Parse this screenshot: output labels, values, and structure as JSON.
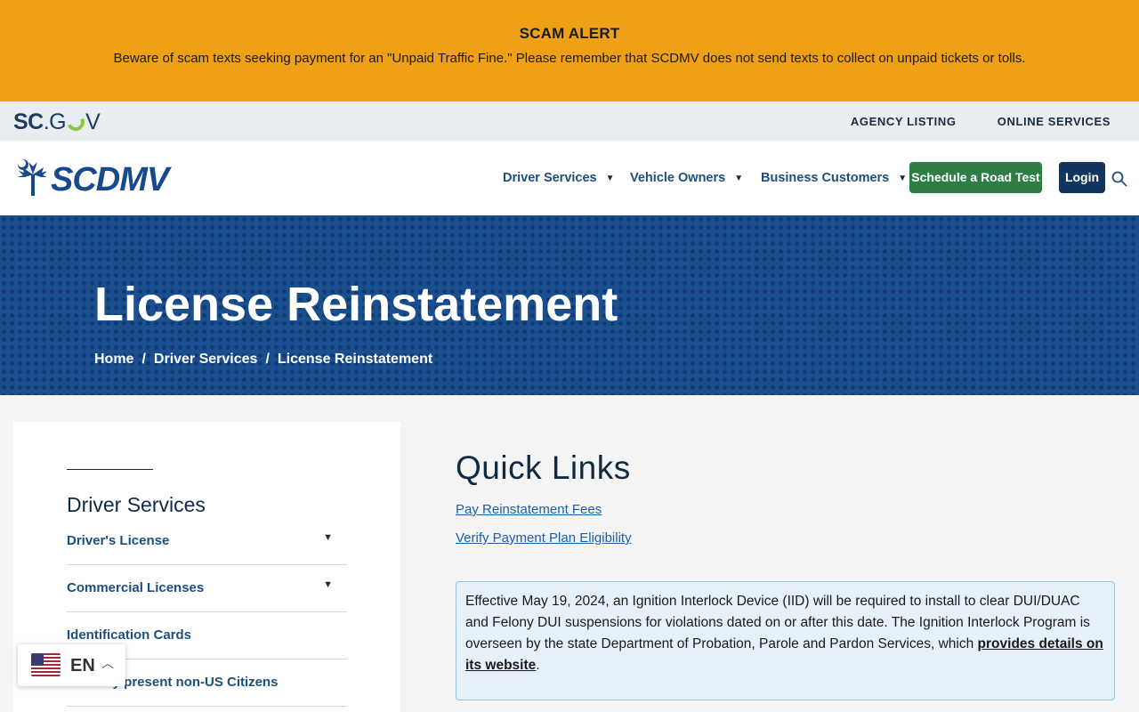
{
  "alert": {
    "title": "SCAM ALERT",
    "message": "Beware of scam texts seeking payment for an \"Unpaid Traffic Fine.\" Please remember that SCDMV does not send texts to collect on unpaid tickets or tolls."
  },
  "govbar": {
    "logo_sc": "SC",
    "logo_dot": ".G",
    "logo_v": "V",
    "links": [
      "AGENCY LISTING",
      "ONLINE SERVICES"
    ]
  },
  "header": {
    "logo_text": "SCDMV",
    "nav": [
      "Driver Services",
      "Vehicle Owners",
      "Business Customers"
    ],
    "schedule_button": "Schedule a Road Test",
    "login_button": "Login",
    "search_icon": "search-icon"
  },
  "hero": {
    "title": "License Reinstatement",
    "breadcrumb": [
      "Home",
      "Driver Services",
      "License Reinstatement"
    ],
    "separator": "/"
  },
  "sidebar": {
    "title": "Driver Services",
    "items": [
      {
        "label": "Driver's License",
        "expandable": true
      },
      {
        "label": "Commercial Licenses",
        "expandable": true
      },
      {
        "label": "Identification Cards",
        "expandable": false
      },
      {
        "label": "Lawfully present non-US Citizens",
        "expandable": false
      }
    ]
  },
  "main": {
    "quick_links_title": "Quick Links",
    "links": [
      "Pay Reinstatement Fees",
      "Verify Payment Plan Eligibility"
    ],
    "notice_text": "Effective May 19, 2024, an Ignition Interlock Device (IID) will be required to install to clear DUI/DUAC and Felony DUI suspensions for violations dated on or after this date. The Ignition Interlock Program is overseen by the state Department of Probation, Parole and Pardon Services, which ",
    "notice_link": "provides details on its website",
    "notice_end": "."
  },
  "language": {
    "code": "EN",
    "flag_icon": "us-flag-icon"
  },
  "colors": {
    "alert": "#f0a017",
    "hero": "#1a4f8f",
    "primary_button": "#2e7d46",
    "login_button": "#12355b",
    "link": "#1d4f7e"
  }
}
